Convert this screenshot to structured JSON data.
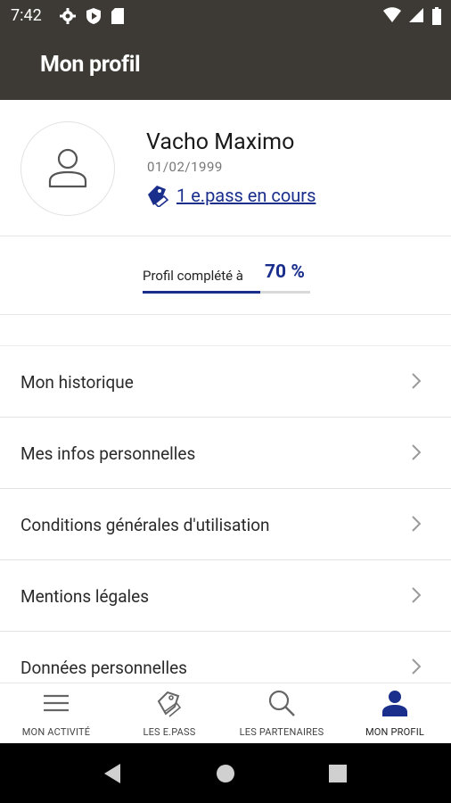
{
  "status_bar": {
    "time": "7:42"
  },
  "app_bar": {
    "title": "Mon profil"
  },
  "profile": {
    "name": "Vacho Maximo",
    "birthdate": "01/02/1999",
    "epass_link": "1 e.pass en cours"
  },
  "completion": {
    "label": "Profil complété à",
    "value": "70 %",
    "percent": 70
  },
  "menu": [
    {
      "label": "Mon historique"
    },
    {
      "label": "Mes infos personnelles"
    },
    {
      "label": "Conditions générales d'utilisation"
    },
    {
      "label": "Mentions légales"
    },
    {
      "label": "Données personnelles"
    }
  ],
  "bottom_nav": [
    {
      "label": "MON ACTIVITÉ",
      "icon": "menu-lines-icon",
      "active": false
    },
    {
      "label": "LES E.PASS",
      "icon": "tag-icon",
      "active": false
    },
    {
      "label": "LES PARTENAIRES",
      "icon": "search-icon",
      "active": false
    },
    {
      "label": "MON PROFIL",
      "icon": "person-icon",
      "active": true
    }
  ],
  "colors": {
    "app_bar": "#3d3a35",
    "accent": "#1a2e8c"
  }
}
